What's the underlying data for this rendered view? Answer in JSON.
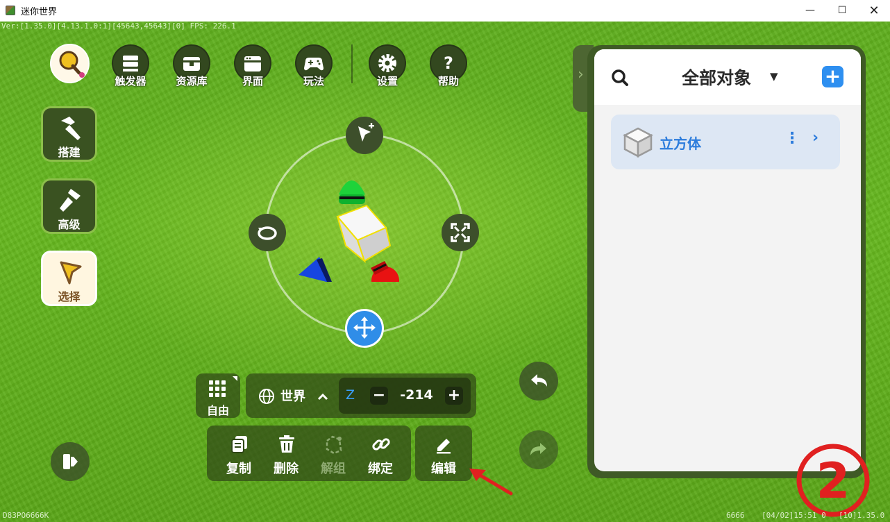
{
  "window": {
    "title": "迷你世界",
    "minimize": "—",
    "maximize": "☐",
    "close": "✕"
  },
  "hud": {
    "version_line": "Ver:[1.35.0][4.13.1.0:1][45643,45643][0] FPS: 226.1",
    "bottom_left": "D83PO6666K",
    "bottom_right_id": "6666",
    "bottom_right_time": "[04/02]15:51 0",
    "bottom_right_ver": "[10]1.35.0"
  },
  "toolbar": {
    "items": [
      {
        "label": "触发器",
        "icon": "trigger-icon"
      },
      {
        "label": "资源库",
        "icon": "resource-library-icon"
      },
      {
        "label": "界面",
        "icon": "ui-window-icon"
      },
      {
        "label": "玩法",
        "icon": "gamepad-icon"
      },
      {
        "label": "设置",
        "icon": "gear-icon"
      },
      {
        "label": "帮助",
        "icon": "help-icon"
      }
    ]
  },
  "side_tools": [
    {
      "label": "搭建",
      "icon": "hammer-icon",
      "active": false
    },
    {
      "label": "高级",
      "icon": "advanced-hammer-icon",
      "active": false
    },
    {
      "label": "选择",
      "icon": "select-cursor-icon",
      "active": true
    }
  ],
  "gizmo": {
    "top_icon": "add-cursor-icon",
    "left_icon": "rotate-icon",
    "right_icon": "scale-icon",
    "bottom_icon": "move-icon"
  },
  "coord_bar": {
    "mode_label": "自由",
    "space_label": "世界",
    "axis": "Z",
    "minus": "−",
    "value": "-214",
    "plus": "+"
  },
  "actions": [
    {
      "label": "复制",
      "icon": "copy-icon",
      "enabled": true
    },
    {
      "label": "删除",
      "icon": "trash-icon",
      "enabled": true
    },
    {
      "label": "解组",
      "icon": "ungroup-icon",
      "enabled": false
    },
    {
      "label": "绑定",
      "icon": "link-icon",
      "enabled": true
    }
  ],
  "edit_action": {
    "label": "编辑",
    "icon": "pencil-icon"
  },
  "panel": {
    "title": "全部对象",
    "caret": "▼",
    "add": "+",
    "tab_glyph": "›",
    "objects": [
      {
        "name": "立方体",
        "icon": "cube-icon",
        "more": "⋮",
        "go": "›"
      }
    ]
  },
  "annotation": {
    "step_number": "2",
    "color": "#e02020"
  },
  "colors": {
    "accent_blue": "#2e8ff0",
    "grass": "#66b81f",
    "panel_dark": "#3f5a26",
    "text_blue": "#2c7cdc"
  }
}
